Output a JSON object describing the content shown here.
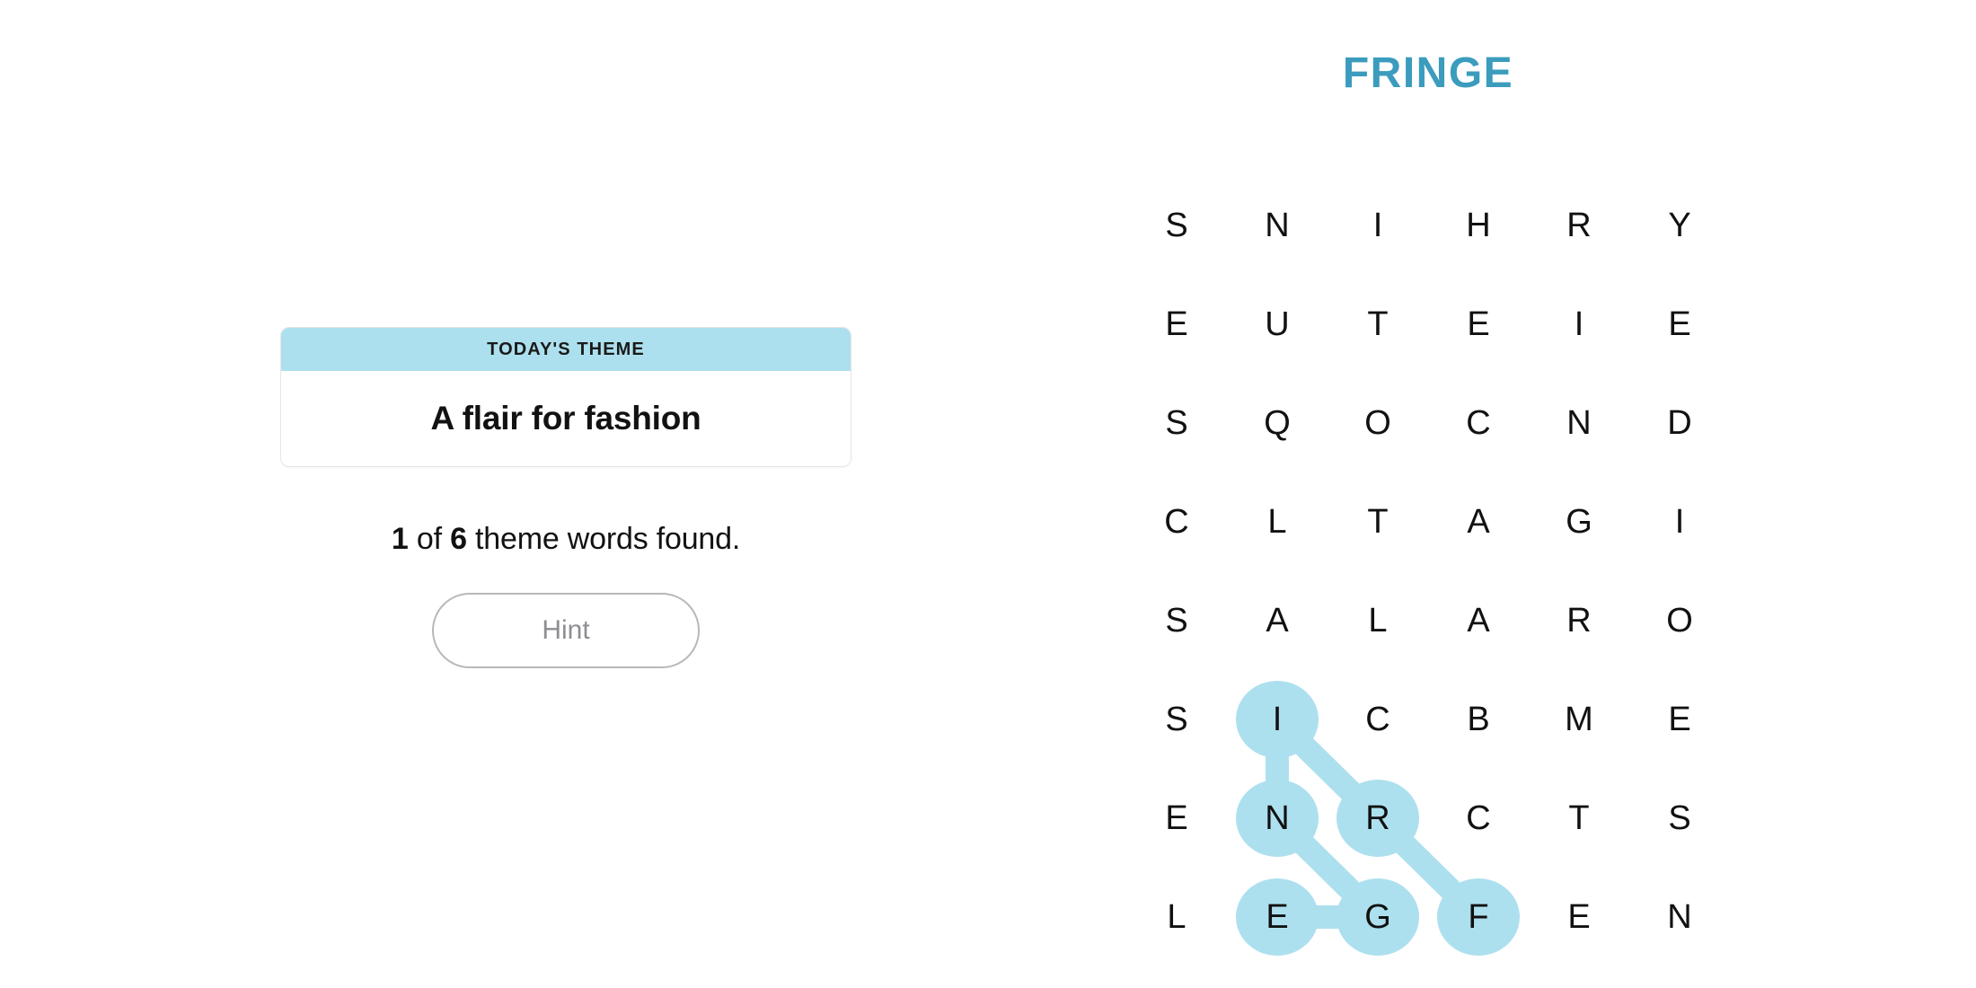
{
  "puzzle": {
    "title": "FRINGE",
    "title_color": "#3b9cbd",
    "highlight_color": "#ade0ee"
  },
  "theme_card": {
    "header_label": "TODAY'S THEME",
    "theme_text": "A flair for fashion"
  },
  "progress": {
    "found_count": "1",
    "of_label": " of ",
    "total_count": "6",
    "suffix": " theme words found."
  },
  "hint_button": {
    "label": "Hint"
  },
  "grid": {
    "columns": 6,
    "rows": 8,
    "letters": [
      [
        "S",
        "N",
        "I",
        "H",
        "R",
        "Y"
      ],
      [
        "E",
        "U",
        "T",
        "E",
        "I",
        "E"
      ],
      [
        "S",
        "Q",
        "O",
        "C",
        "N",
        "D"
      ],
      [
        "C",
        "L",
        "T",
        "A",
        "G",
        "I"
      ],
      [
        "S",
        "A",
        "L",
        "A",
        "R",
        "O"
      ],
      [
        "S",
        "I",
        "C",
        "B",
        "M",
        "E"
      ],
      [
        "E",
        "N",
        "R",
        "C",
        "T",
        "S"
      ],
      [
        "L",
        "E",
        "G",
        "F",
        "E",
        "N"
      ]
    ],
    "found_word": {
      "word": "FRINGE",
      "cells": [
        {
          "row": 7,
          "col": 3,
          "letter": "F"
        },
        {
          "row": 6,
          "col": 2,
          "letter": "R"
        },
        {
          "row": 5,
          "col": 1,
          "letter": "I"
        },
        {
          "row": 6,
          "col": 1,
          "letter": "N"
        },
        {
          "row": 7,
          "col": 1,
          "letter": "E"
        },
        {
          "row": 7,
          "col": 2,
          "letter": "G"
        }
      ],
      "connections": [
        {
          "from": {
            "row": 5,
            "col": 1
          },
          "to": {
            "row": 6,
            "col": 1
          }
        },
        {
          "from": {
            "row": 5,
            "col": 1
          },
          "to": {
            "row": 6,
            "col": 2
          }
        },
        {
          "from": {
            "row": 6,
            "col": 1
          },
          "to": {
            "row": 7,
            "col": 2
          }
        },
        {
          "from": {
            "row": 7,
            "col": 1
          },
          "to": {
            "row": 7,
            "col": 2
          }
        },
        {
          "from": {
            "row": 6,
            "col": 2
          },
          "to": {
            "row": 7,
            "col": 3
          }
        }
      ]
    }
  }
}
